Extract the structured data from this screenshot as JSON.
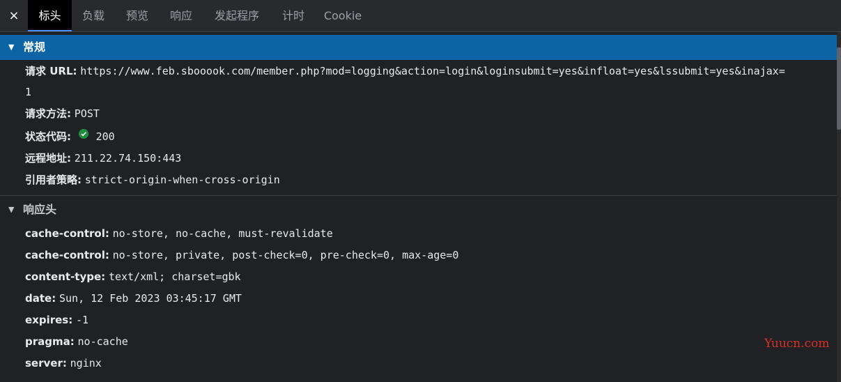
{
  "tabs": {
    "close_icon": "×",
    "items": [
      "标头",
      "负载",
      "预览",
      "响应",
      "发起程序",
      "计时",
      "Cookie"
    ]
  },
  "general": {
    "title": "常规",
    "request_url_key": "请求 URL:",
    "request_url_value_1": "https://www.feb.sbooook.com/member.php?mod=logging&action=login&loginsubmit=yes&infloat=yes&lssubmit=yes&inajax=",
    "request_url_value_2": "1",
    "method_key": "请求方法:",
    "method_value": "POST",
    "status_key": "状态代码:",
    "status_value": "200",
    "remote_key": "远程地址:",
    "remote_value": "211.22.74.150:443",
    "referrer_key": "引用者策略:",
    "referrer_value": "strict-origin-when-cross-origin"
  },
  "response_headers": {
    "title": "响应头",
    "rows": [
      {
        "key": "cache-control:",
        "value": "no-store, no-cache, must-revalidate"
      },
      {
        "key": "cache-control:",
        "value": "no-store, private, post-check=0, pre-check=0, max-age=0"
      },
      {
        "key": "content-type:",
        "value": "text/xml; charset=gbk"
      },
      {
        "key": "date:",
        "value": "Sun, 12 Feb 2023 03:45:17 GMT"
      },
      {
        "key": "expires:",
        "value": "-1"
      },
      {
        "key": "pragma:",
        "value": "no-cache"
      },
      {
        "key": "server:",
        "value": "nginx"
      }
    ]
  },
  "watermark": "Yuucn.com",
  "colors": {
    "selected_header": "#0d64a5",
    "status_ok": "#1e8e3e",
    "watermark": "#d93025"
  }
}
